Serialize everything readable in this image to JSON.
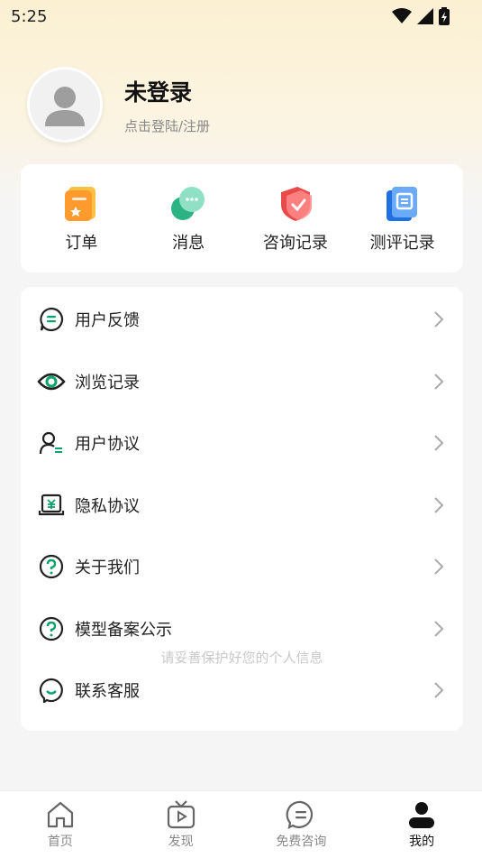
{
  "status_bar": {
    "time": "5:25"
  },
  "profile": {
    "name": "未登录",
    "subtitle": "点击登陆/注册"
  },
  "quick_actions": [
    {
      "label": "订单",
      "icon": "order-icon"
    },
    {
      "label": "消息",
      "icon": "message-icon"
    },
    {
      "label": "咨询记录",
      "icon": "consult-record-icon"
    },
    {
      "label": "测评记录",
      "icon": "assessment-record-icon"
    }
  ],
  "menu": [
    {
      "label": "用户反馈",
      "icon": "feedback-icon"
    },
    {
      "label": "浏览记录",
      "icon": "eye-icon"
    },
    {
      "label": "用户协议",
      "icon": "user-agreement-icon"
    },
    {
      "label": "隐私协议",
      "icon": "privacy-icon"
    },
    {
      "label": "关于我们",
      "icon": "question-icon"
    },
    {
      "label": "模型备案公示",
      "icon": "question-icon"
    },
    {
      "label": "联系客服",
      "icon": "chat-icon"
    }
  ],
  "watermark": "请妥善保护好您的个人信息",
  "tabbar": [
    {
      "label": "首页",
      "icon": "home-icon",
      "active": false
    },
    {
      "label": "发现",
      "icon": "tv-icon",
      "active": false
    },
    {
      "label": "免费咨询",
      "icon": "chat-bubble-icon",
      "active": false
    },
    {
      "label": "我的",
      "icon": "person-icon",
      "active": true
    }
  ],
  "colors": {
    "accent_green": "#0aa36b",
    "header_gradient": "#fbf0d2",
    "background": "#f5f5f5"
  }
}
